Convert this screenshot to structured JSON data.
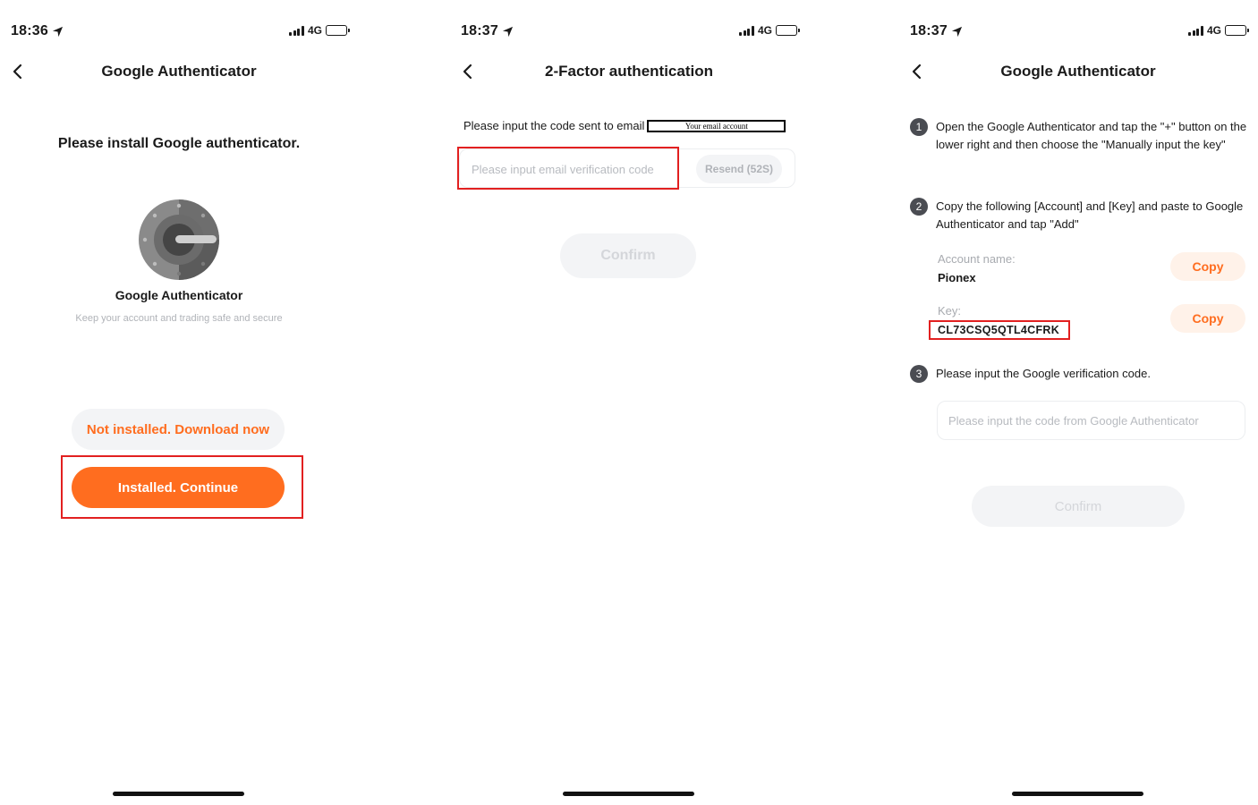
{
  "screens": [
    {
      "time": "18:36",
      "network": "4G",
      "title": "Google Authenticator",
      "heading": "Please install Google authenticator.",
      "app_name": "Google Authenticator",
      "app_subtitle": "Keep your account and trading safe and secure",
      "download_button": "Not installed. Download now",
      "continue_button": "Installed. Continue"
    },
    {
      "time": "18:37",
      "network": "4G",
      "title": "2-Factor authentication",
      "prompt": "Please input the code sent to email",
      "email_redacted": "Your email account",
      "code_placeholder": "Please input email verification code",
      "resend_button": "Resend (52S)",
      "confirm_button": "Confirm"
    },
    {
      "time": "18:37",
      "network": "4G",
      "title": "Google Authenticator",
      "steps": [
        {
          "num": "1",
          "text": "Open the Google Authenticator and tap the \"+\" button on the lower right and then choose the \"Manually input the key\""
        },
        {
          "num": "2",
          "text": "Copy the following [Account] and [Key] and paste to Google Authenticator and tap \"Add\""
        },
        {
          "num": "3",
          "text": "Please input the Google verification code."
        }
      ],
      "account_label": "Account name:",
      "account_value": "Pionex",
      "key_label": "Key:",
      "key_value": "CL73CSQ5QTL4CFRK",
      "copy_button": "Copy",
      "code_placeholder": "Please input the code from Google Authenticator",
      "confirm_button": "Confirm"
    }
  ],
  "colors": {
    "accent": "#ff6d1f",
    "accent_soft": "#fff2e9",
    "highlight": "#e22020",
    "disabled_bg": "#f3f4f6",
    "disabled_text": "#d4d6da"
  }
}
